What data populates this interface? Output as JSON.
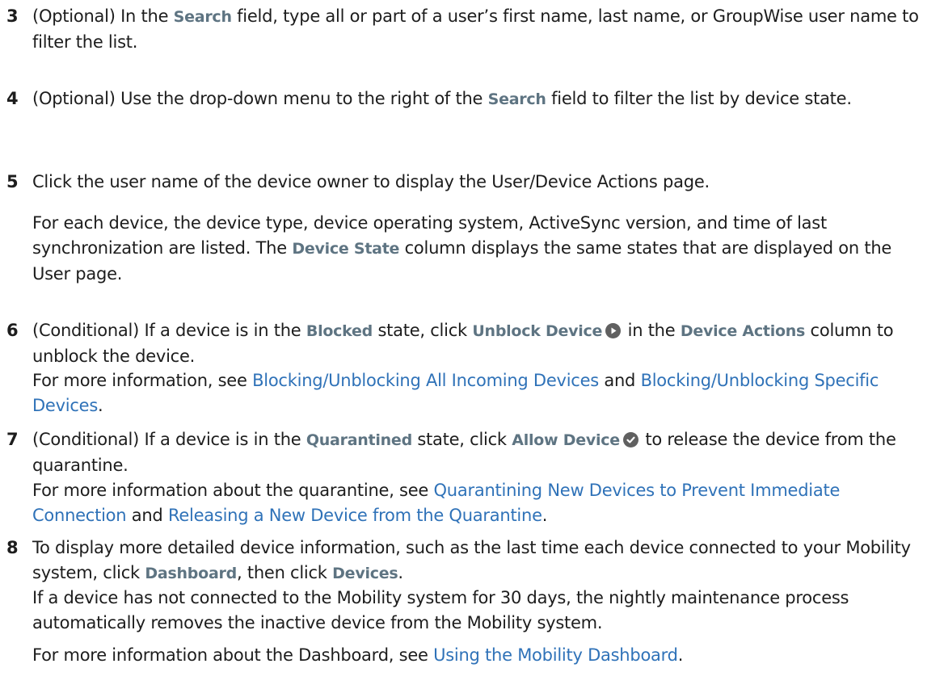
{
  "steps": [
    {
      "number": "3",
      "text": {
        "t1": "(Optional) In the ",
        "ui1": "Search",
        "t2": " field, type all or part of a user’s first name, last name, or GroupWise user name to filter the list."
      }
    },
    {
      "number": "4",
      "text": {
        "t1": "(Optional) Use the drop-down menu to the right of the ",
        "ui1": "Search",
        "t2": " field to filter the list by device state."
      }
    },
    {
      "number": "5",
      "text": "Click the user name of the device owner to display the User/Device Actions page.",
      "note": {
        "t1": "For each device, the device type, device operating system, ActiveSync version, and time of last synchronization are listed. The ",
        "ui1": "Device State",
        "t2": " column displays the same states that are displayed on the User page."
      }
    },
    {
      "number": "6",
      "text": {
        "t1": "(Conditional) If a device is in the ",
        "ui1": "Blocked",
        "t2": " state, click ",
        "ui2": "Unblock Device",
        "icon": "play-circle-icon",
        "t3": " in the ",
        "ui3": "Device Actions",
        "t4": " column to unblock the device."
      },
      "note": {
        "t1": "For more information, see ",
        "link1": "Blocking/Unblocking All Incoming Devices",
        "t2": " and ",
        "link2": "Blocking/Unblocking Specific Devices",
        "t3": "."
      }
    },
    {
      "number": "7",
      "text": {
        "t1": "(Conditional) If a device is in the ",
        "ui1": "Quarantined",
        "t2": " state, click ",
        "ui2": "Allow Device",
        "icon": "check-circle-icon",
        "t3": " to release the device from the quarantine."
      },
      "note": {
        "t1": "For more information about the quarantine, see ",
        "link1": "Quarantining New Devices to Prevent Immediate Connection",
        "t2": " and ",
        "link2": "Releasing a New Device from the Quarantine",
        "t3": "."
      }
    },
    {
      "number": "8",
      "text": {
        "t1": "To display more detailed device information, such as the last time each device connected to your Mobility system, click ",
        "ui1": "Dashboard",
        "t2": ", then click ",
        "ui2": "Devices",
        "t3": "."
      },
      "note": "If a device has not connected to the Mobility system for 30 days, the nightly maintenance process automatically removes the inactive device from the Mobility system.",
      "note2": {
        "t1": "For more information about the Dashboard, see ",
        "link1": "Using the Mobility Dashboard",
        "t2": "."
      }
    }
  ],
  "colors": {
    "text": "#1d1d1d",
    "ui_term": "#5e7482",
    "link": "#2f72b8",
    "icon": "#606060"
  }
}
